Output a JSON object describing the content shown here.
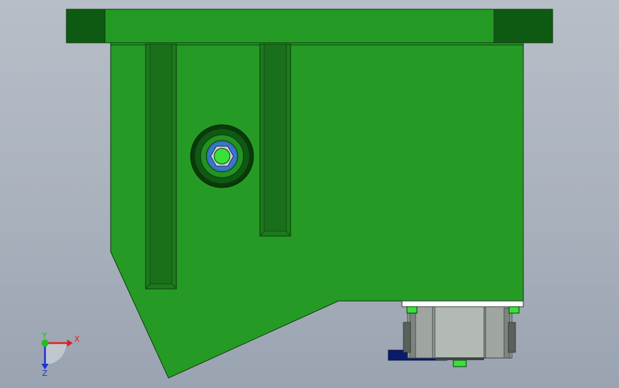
{
  "viewport": {
    "background_top": "#b7bec7",
    "background_bottom": "#9aa3b1"
  },
  "model": {
    "body_color": "#259b25",
    "dark_green": "#0f5a12",
    "edge_color": "#0e3a0e",
    "motor_gray": "#b3b9b3",
    "motor_dark": "#3f4543",
    "base_plate": "#0b1b6b",
    "bolt_green": "#37e13a",
    "shaft_blue": "#2f7bd9"
  },
  "triad": {
    "x_label": "X",
    "y_label": "Y",
    "z_label": "Z",
    "x_color": "#e02020",
    "y_color": "#20c020",
    "z_color": "#2030d0"
  }
}
